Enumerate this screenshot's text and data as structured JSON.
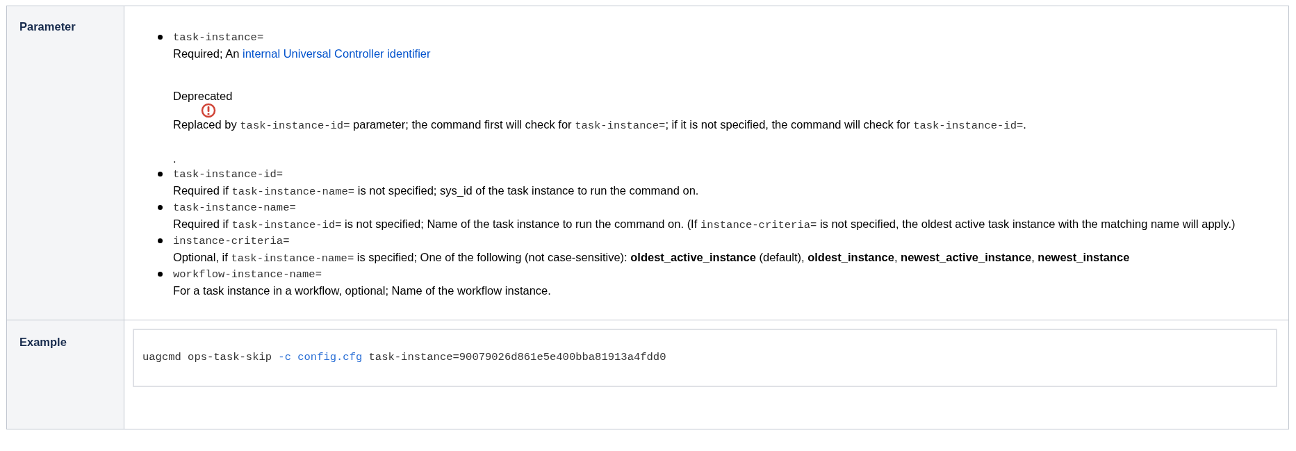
{
  "rows": [
    {
      "header": "Parameter",
      "kind": "params",
      "items": [
        {
          "name": "task-instance=",
          "paragraphs": [
            {
              "kind": "text",
              "segments": [
                {
                  "kind": "text",
                  "text": "Required; An "
                },
                {
                  "kind": "link",
                  "text": "internal Universal Controller identifier"
                }
              ]
            },
            {
              "kind": "warning",
              "title": "Deprecated",
              "segments": [
                {
                  "kind": "text",
                  "text": "Replaced by "
                },
                {
                  "kind": "code",
                  "text": "task-instance-id="
                },
                {
                  "kind": "text",
                  "text": " parameter; the command first will check for "
                },
                {
                  "kind": "code",
                  "text": "task-instance="
                },
                {
                  "kind": "text",
                  "text": "; if it is not specified, the command will check for "
                },
                {
                  "kind": "code",
                  "text": "task-instance-id="
                },
                {
                  "kind": "text",
                  "text": "."
                }
              ]
            },
            {
              "kind": "text",
              "segments": [
                {
                  "kind": "text",
                  "text": "."
                }
              ]
            }
          ]
        },
        {
          "name": "task-instance-id=",
          "paragraphs": [
            {
              "kind": "text",
              "segments": [
                {
                  "kind": "text",
                  "text": "Required if "
                },
                {
                  "kind": "code",
                  "text": "task-instance-name="
                },
                {
                  "kind": "text",
                  "text": " is not specified; sys_id of the task instance to run the command on."
                }
              ]
            }
          ]
        },
        {
          "name": "task-instance-name=",
          "paragraphs": [
            {
              "kind": "text",
              "segments": [
                {
                  "kind": "text",
                  "text": "Required if "
                },
                {
                  "kind": "code",
                  "text": "task-instance-id="
                },
                {
                  "kind": "text",
                  "text": " is not specified; Name of the task instance to run the command on. (If "
                },
                {
                  "kind": "code",
                  "text": "instance-criteria="
                },
                {
                  "kind": "text",
                  "text": " is not specified, the oldest active task instance with the matching name will apply.)"
                }
              ]
            }
          ]
        },
        {
          "name": "instance-criteria=",
          "paragraphs": [
            {
              "kind": "text",
              "segments": [
                {
                  "kind": "text",
                  "text": "Optional, if "
                },
                {
                  "kind": "code",
                  "text": "task-instance-name="
                },
                {
                  "kind": "text",
                  "text": " is specified; One of the following (not case-sensitive): "
                },
                {
                  "kind": "bold",
                  "text": "oldest_active_instance"
                },
                {
                  "kind": "text",
                  "text": " (default), "
                },
                {
                  "kind": "bold",
                  "text": "oldest_instance"
                },
                {
                  "kind": "text",
                  "text": ", "
                },
                {
                  "kind": "bold",
                  "text": "newest_active_instance"
                },
                {
                  "kind": "text",
                  "text": ", "
                },
                {
                  "kind": "bold",
                  "text": "newest_instance"
                }
              ]
            }
          ]
        },
        {
          "name": "workflow-instance-name=",
          "paragraphs": [
            {
              "kind": "text",
              "segments": [
                {
                  "kind": "text",
                  "text": "For a task instance in a workflow, optional; Name of the workflow instance."
                }
              ]
            }
          ]
        }
      ]
    },
    {
      "header": "Example",
      "kind": "code",
      "tokens": [
        {
          "kind": "plain",
          "text": "uagcmd ops-task-skip "
        },
        {
          "kind": "option",
          "text": "-c "
        },
        {
          "kind": "value",
          "text": "config.cfg"
        },
        {
          "kind": "plain",
          "text": " task-instance=90079026d861e5e400bba81913a4fdd0"
        }
      ]
    }
  ]
}
